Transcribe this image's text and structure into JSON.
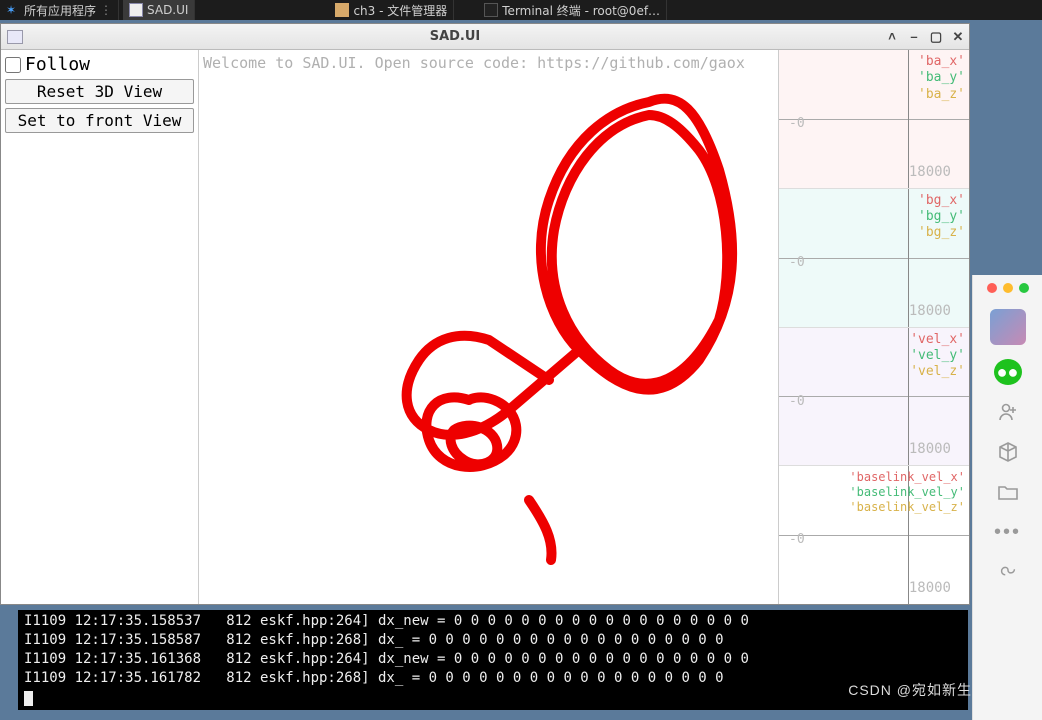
{
  "taskbar": {
    "apps_label": "所有应用程序",
    "items": [
      {
        "label": "SAD.UI"
      },
      {
        "label": "ch3 - 文件管理器"
      },
      {
        "label": "Terminal 终端 - root@0ef…"
      }
    ]
  },
  "window": {
    "title": "SAD.UI",
    "controls": {
      "follow_label": "Follow",
      "follow_checked": false,
      "reset_btn": "Reset 3D View",
      "front_btn": "Set to front View"
    },
    "welcome": "Welcome to SAD.UI. Open source code: https://github.com/gaox",
    "win_btns": {
      "roll": "˄",
      "min": "–",
      "max": "▢",
      "close": "✕"
    }
  },
  "plots": [
    {
      "bg": "bg1",
      "series": [
        "'ba_x'",
        "'ba_y'",
        "'ba_z'"
      ],
      "xtick": "18000",
      "zero": "-0"
    },
    {
      "bg": "bg2",
      "series": [
        "'bg_x'",
        "'bg_y'",
        "'bg_z'"
      ],
      "xtick": "18000",
      "zero": "-0"
    },
    {
      "bg": "bg3",
      "series": [
        "'vel_x'",
        "'vel_y'",
        "'vel_z'"
      ],
      "xtick": "18000",
      "zero": "-0"
    },
    {
      "bg": "",
      "series": [
        "'baselink_vel_x'",
        "'baselink_vel_y'",
        "'baselink_vel_z'"
      ],
      "xtick": "18000",
      "zero": "-0"
    }
  ],
  "terminal": {
    "lines": [
      "I1109 12:17:35.158537   812 eskf.hpp:264] dx_new = 0 0 0 0 0 0 0 0 0 0 0 0 0 0 0 0 0 0",
      "I1109 12:17:35.158587   812 eskf.hpp:268] dx_ = 0 0 0 0 0 0 0 0 0 0 0 0 0 0 0 0 0 0",
      "I1109 12:17:35.161368   812 eskf.hpp:264] dx_new = 0 0 0 0 0 0 0 0 0 0 0 0 0 0 0 0 0 0",
      "I1109 12:17:35.161782   812 eskf.hpp:268] dx_ = 0 0 0 0 0 0 0 0 0 0 0 0 0 0 0 0 0 0"
    ]
  },
  "dock": {
    "icons": [
      "chat",
      "contacts",
      "cube",
      "folder",
      "more",
      "mini"
    ]
  },
  "watermark": "CSDN @宛如新生"
}
